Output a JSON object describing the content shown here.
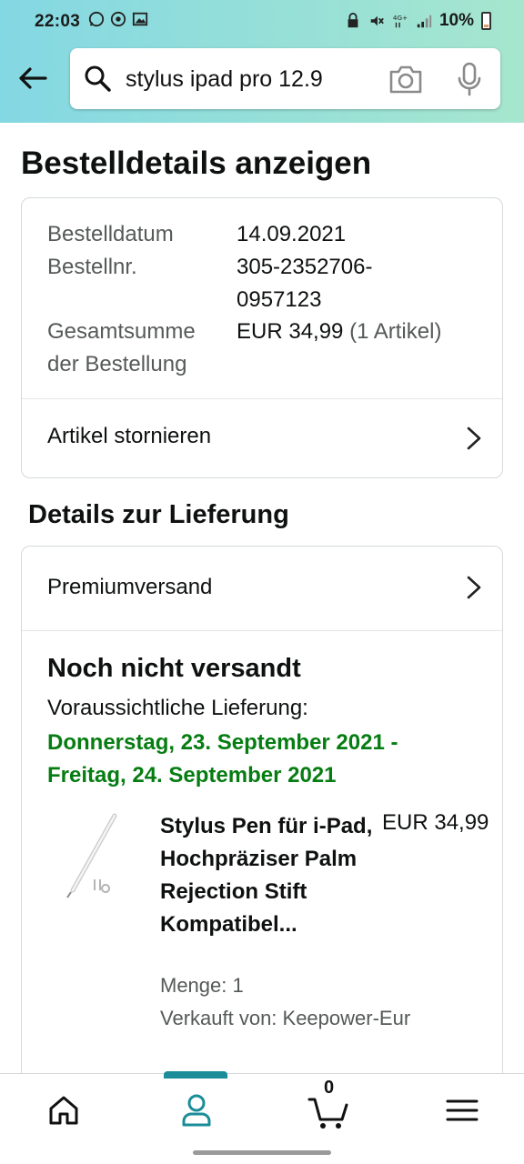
{
  "status_bar": {
    "time": "22:03",
    "battery": "10%",
    "network": "4G+"
  },
  "search": {
    "query": "stylus ipad pro 12.9"
  },
  "page": {
    "title": "Bestelldetails anzeigen"
  },
  "order": {
    "date_label": "Bestelldatum",
    "date_value": "14.09.2021",
    "number_label": "Bestellnr.",
    "number_value_line1": "305-2352706-",
    "number_value_line2": "0957123",
    "total_label_line1": "Gesamtsumme",
    "total_label_line2": "der Bestellung",
    "total_value": "EUR 34,99",
    "total_items": "(1 Artikel)",
    "cancel_label": "Artikel stornieren"
  },
  "delivery": {
    "section_title": "Details zur Lieferung",
    "shipping_method": "Premiumversand",
    "status": "Noch nicht versandt",
    "expected_label": "Voraussichtliche Lieferung:",
    "expected_dates": "Donnerstag, 23. September 2021 - Freitag, 24. September 2021"
  },
  "product": {
    "name": "Stylus Pen für i-Pad, Hochpräziser Palm Rejection Stift Kompatibel...",
    "price": "EUR 34,99",
    "quantity": "Menge: 1",
    "seller": "Verkauft von: Keepower-Eur"
  },
  "bottom_nav": {
    "items": [
      "home-icon",
      "account-icon",
      "cart-icon",
      "menu-icon"
    ],
    "cart_count": "0",
    "active": "account-icon"
  },
  "colors": {
    "delivery_green": "#067d12",
    "nav_active": "#1a8d98",
    "header_gradient_start": "#84d8e3",
    "header_gradient_end": "#a6e6ce"
  }
}
